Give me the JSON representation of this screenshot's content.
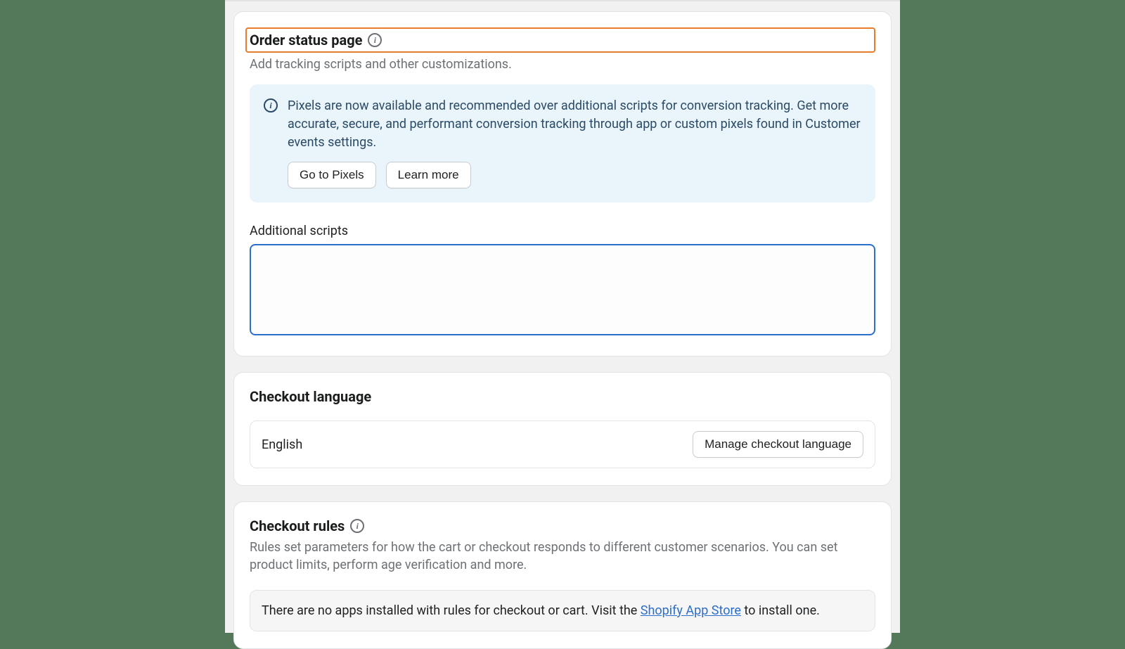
{
  "orderStatus": {
    "title": "Order status page",
    "subtitle": "Add tracking scripts and other customizations.",
    "banner": {
      "text": "Pixels are now available and recommended over additional scripts for conversion tracking. Get more accurate, secure, and performant conversion tracking through app or custom pixels found in Customer events settings.",
      "goToPixels": "Go to Pixels",
      "learnMore": "Learn more"
    },
    "scriptsLabel": "Additional scripts",
    "scriptsValue": ""
  },
  "checkoutLanguage": {
    "title": "Checkout language",
    "value": "English",
    "manage": "Manage checkout language"
  },
  "checkoutRules": {
    "title": "Checkout rules",
    "desc": "Rules set parameters for how the cart or checkout responds to different customer scenarios. You can set product limits, perform age verification and more.",
    "emptyPrefix": "There are no apps installed with rules for checkout or cart. Visit the ",
    "emptyLink": "Shopify App Store",
    "emptySuffix": " to install one."
  }
}
